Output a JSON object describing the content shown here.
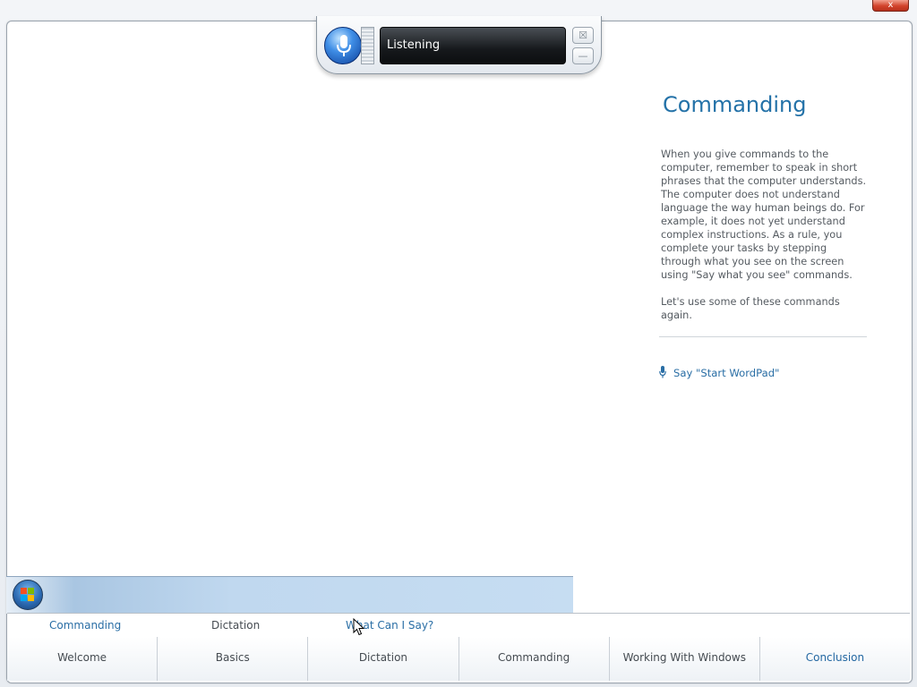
{
  "window": {
    "close_glyph": "x"
  },
  "speech": {
    "status": "Listening",
    "close_glyph": "☒",
    "minimize_glyph": "—"
  },
  "panel": {
    "title": "Commanding",
    "paragraph1": "When you give commands to the computer, remember to speak in short phrases that the computer understands. The computer does not understand language the way human beings do. For example, it does not yet understand complex instructions. As a rule, you complete your tasks by stepping through what you see on the screen using \"Say what you see\" commands.",
    "paragraph2": "Let's use some of these commands again.",
    "say_prompt": "Say \"Start WordPad\""
  },
  "subnav": {
    "items": [
      {
        "label": "Commanding",
        "color": "#2a6ea5"
      },
      {
        "label": "Dictation",
        "color": "#454b51"
      },
      {
        "label": "What Can I Say?",
        "color": "#2a6ea5"
      }
    ]
  },
  "bottomnav": {
    "tabs": [
      {
        "label": "Welcome",
        "active": false
      },
      {
        "label": "Basics",
        "active": false
      },
      {
        "label": "Dictation",
        "active": false
      },
      {
        "label": "Commanding",
        "active": false
      },
      {
        "label": "Working With Windows",
        "active": false
      },
      {
        "label": "Conclusion",
        "active": true
      }
    ]
  },
  "colors": {
    "accent": "#2472a8",
    "taskbar": "#c0d8ef"
  }
}
